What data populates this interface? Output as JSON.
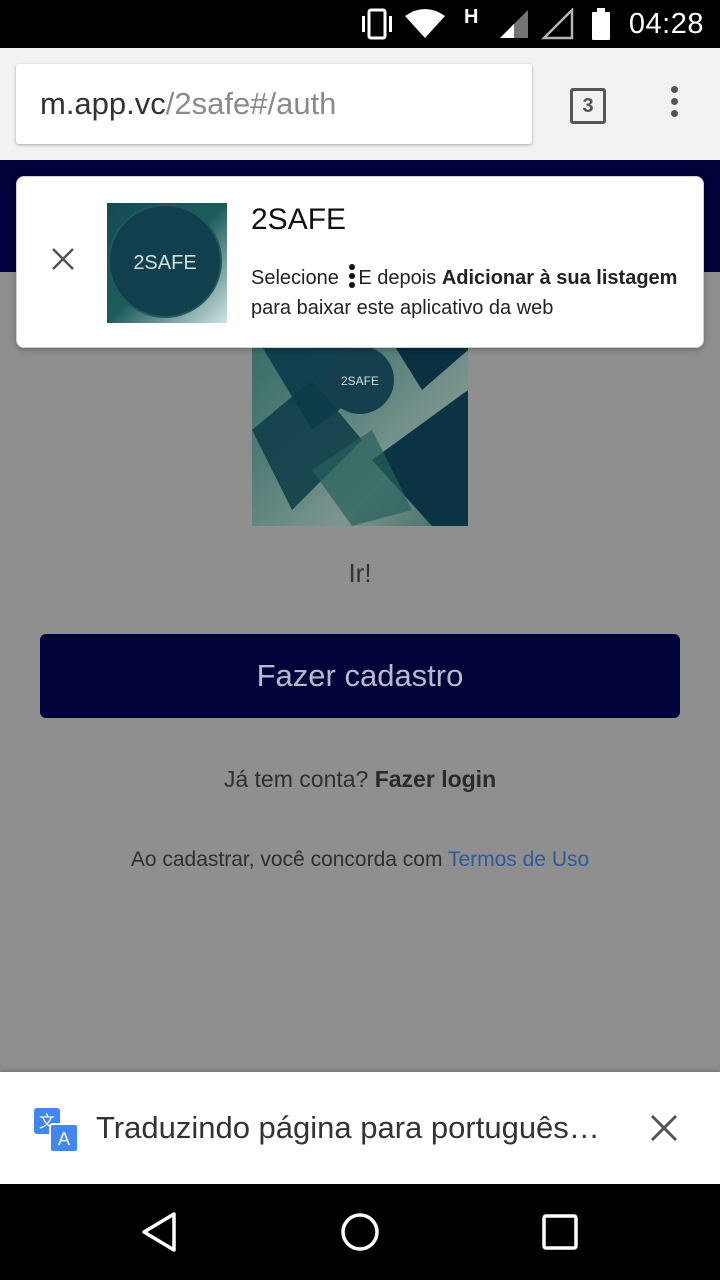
{
  "status_bar": {
    "time": "04:28",
    "network_label": "H",
    "icons": [
      "vibrate-icon",
      "wifi-icon",
      "signal-icon",
      "signal-empty-icon",
      "battery-icon"
    ]
  },
  "browser": {
    "url_host": "m.app.vc",
    "url_path": "/2safe#/auth",
    "tab_count": "3",
    "menu_icon": "more-vert-icon"
  },
  "install_banner": {
    "app_name": "2SAFE",
    "icon_text": "2SAFE",
    "desc_prefix": "Selecione",
    "desc_middle": "E depois",
    "desc_bold": "Adicionar à sua listagem",
    "desc_suffix": "para baixar este aplicativo da web"
  },
  "page": {
    "logo_text": "2SAFE",
    "go_text": "Ir!",
    "signup_button": "Fazer cadastro",
    "login_prompt": "Já tem conta?",
    "login_link": "Fazer login",
    "terms_prefix": "Ao cadastrar, você concorda com",
    "terms_link": "Termos de Uso"
  },
  "translate_bar": {
    "text": "Traduzindo página para português…",
    "icon": "translate-icon"
  },
  "colors": {
    "brand_navy": "#02023a",
    "overlay_gray": "#8f8f8f",
    "link_blue": "#2f5a9a"
  }
}
